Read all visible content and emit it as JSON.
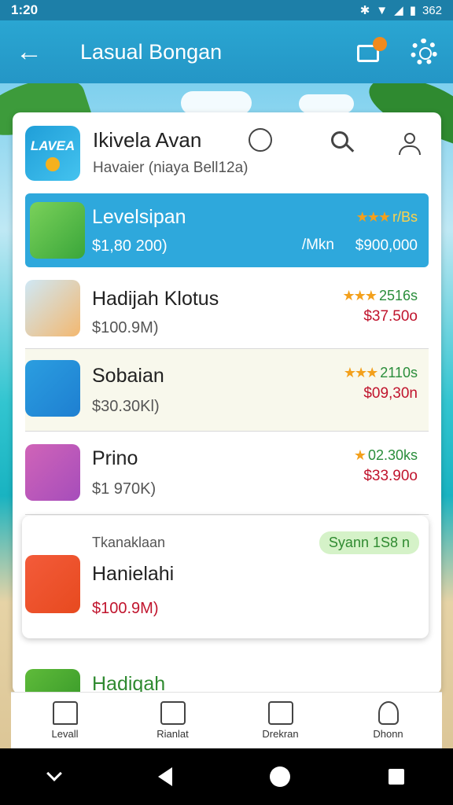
{
  "status_bar": {
    "time": "1:20",
    "battery": "362"
  },
  "app_bar": {
    "title": "Lasual Bongan"
  },
  "card_header": {
    "logo_text": "LAVEA",
    "title": "Ikivela Avan",
    "subtitle": "Havaier (niaya Bell12a)"
  },
  "items": [
    {
      "name": "Levelsipan",
      "sub": "$1,80 200)",
      "stars": "★★★",
      "rating_text": "r/Bs",
      "tag": "/Mkn",
      "price": "$900,000"
    },
    {
      "name": "Hadijah Klotus",
      "sub": "$100.9M)",
      "stars": "★★★",
      "rating_text": "2516s",
      "price": "$37.50o"
    },
    {
      "name": "Sobaian",
      "sub": "$30.30Kl)",
      "stars": "★★★",
      "rating_text": "2110s",
      "price": "$09,30n"
    },
    {
      "name": "Prino",
      "sub": "$1 970K)",
      "stars": "★",
      "rating_text": "02.30ks",
      "price": "$33.90o"
    }
  ],
  "feature_card": {
    "label": "Tkanaklaan",
    "badge": "Syann 1S8 n",
    "name": "Hanielahi",
    "price": "$100.9M)"
  },
  "peek_card": {
    "name": "Hadiqah"
  },
  "bottom_nav": [
    {
      "label": "Levall"
    },
    {
      "label": "Rianlat"
    },
    {
      "label": "Drekran"
    },
    {
      "label": "Dhonn"
    }
  ]
}
